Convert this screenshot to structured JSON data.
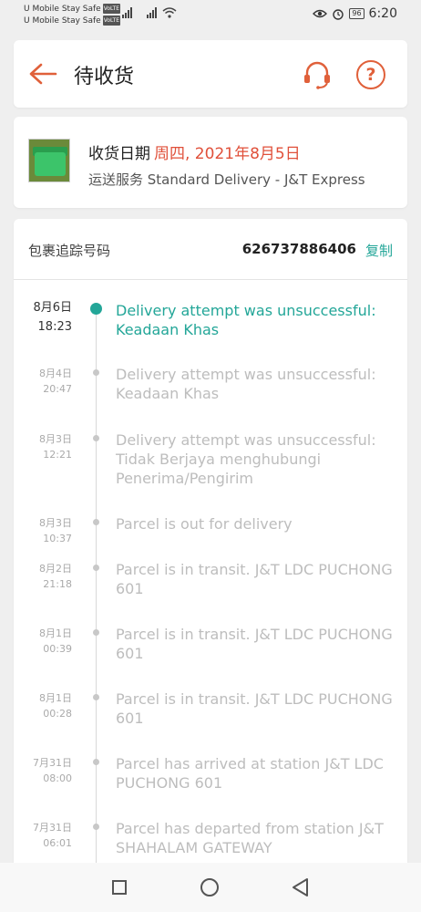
{
  "status_bar": {
    "carrier_1": "U Mobile Stay Safe",
    "carrier_2": "U Mobile Stay Safe",
    "volte_badge": "VoLTE",
    "battery": "96",
    "time": "6:20"
  },
  "header": {
    "title": "待收货",
    "back_icon": "arrow-left-icon",
    "support_icon": "headset-icon",
    "help_icon": "question-icon",
    "help_glyph": "?",
    "accent_color": "#e0603a"
  },
  "delivery": {
    "date_label": "收货日期",
    "date_value": "周四, 2021年8月5日",
    "service": "运送服务 Standard Delivery  - J&T Express"
  },
  "tracking": {
    "label": "包裹追踪号码",
    "number": "626737886406",
    "copy_label": "复制",
    "accent_color": "#23a698",
    "events": [
      {
        "date": "8月6日",
        "time": "18:23",
        "text": "Delivery attempt was unsuccessful: Keadaan Khas",
        "active": true
      },
      {
        "date": "8月4日",
        "time": "20:47",
        "text": "Delivery attempt was unsuccessful: Keadaan Khas",
        "active": false
      },
      {
        "date": "8月3日",
        "time": "12:21",
        "text": "Delivery attempt was unsuccessful: Tidak Berjaya menghubungi Penerima/Pengirim",
        "active": false
      },
      {
        "date": "8月3日",
        "time": "10:37",
        "text": "Parcel is out for delivery",
        "active": false
      },
      {
        "date": "8月2日",
        "time": "21:18",
        "text": "Parcel is in transit. J&T LDC PUCHONG 601",
        "active": false
      },
      {
        "date": "8月1日",
        "time": "00:39",
        "text": "Parcel is in transit. J&T LDC PUCHONG 601",
        "active": false
      },
      {
        "date": "8月1日",
        "time": "00:28",
        "text": "Parcel is in transit. J&T LDC PUCHONG 601",
        "active": false
      },
      {
        "date": "7月31日",
        "time": "08:00",
        "text": "Parcel has arrived at station J&T LDC PUCHONG 601",
        "active": false
      },
      {
        "date": "7月31日",
        "time": "06:01",
        "text": "Parcel has departed from station J&T SHAHALAM GATEWAY",
        "active": false
      }
    ]
  },
  "nav_bar": {
    "recents_icon": "square-icon",
    "home_icon": "circle-icon",
    "back_icon": "triangle-back-icon"
  }
}
